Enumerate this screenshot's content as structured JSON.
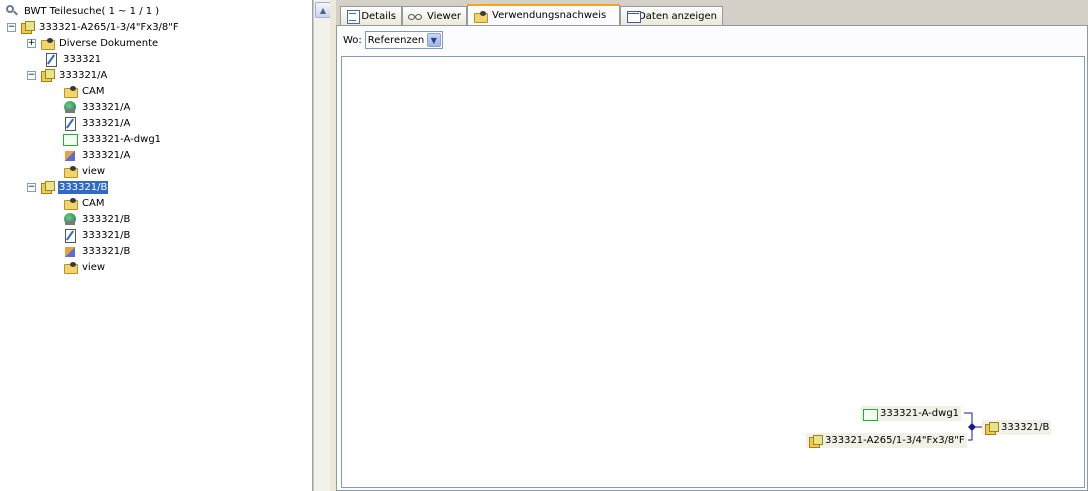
{
  "tree": {
    "root_label": "BWT Teilesuche( 1 ~ 1 / 1 )",
    "top_part": "333321-A265/1-3/4\"Fx3/8\"F",
    "diverse_docs": "Diverse Dokumente",
    "doc_333321": "333321",
    "rev_a": {
      "label": "333321/A",
      "children": {
        "cam": "CAM",
        "cam_part": "333321/A",
        "doc": "333321/A",
        "dwg": "333321-A-dwg1",
        "model": "333321/A",
        "view": "view"
      }
    },
    "rev_b": {
      "label": "333321/B",
      "children": {
        "cam": "CAM",
        "cam_part": "333321/B",
        "doc": "333321/B",
        "model": "333321/B",
        "view": "view"
      }
    }
  },
  "tabs": {
    "details": "Details",
    "viewer": "Viewer",
    "verwendungsnachweis": "Verwendungsnachweis",
    "daten": "Daten anzeigen"
  },
  "filter": {
    "label": "Wo:",
    "value": "Referenzen"
  },
  "graph": {
    "node_dwg": "333321-A-dwg1",
    "node_part": "333321-A265/1-3/4\"Fx3/8\"F",
    "node_target": "333321/B"
  },
  "colors": {
    "selection": "#316ac5",
    "active_tab_accent": "#f4a51d",
    "connector": "#1a1a8c"
  }
}
